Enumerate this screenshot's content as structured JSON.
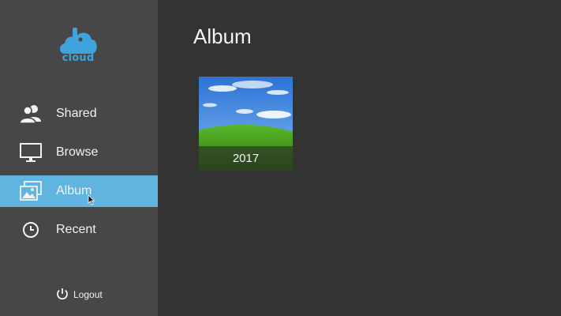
{
  "brand": {
    "logo_text": "cloud",
    "accent_color": "#5fb4e0"
  },
  "sidebar": {
    "items": [
      {
        "label": "Shared",
        "icon": "users-icon",
        "active": false
      },
      {
        "label": "Browse",
        "icon": "monitor-icon",
        "active": false
      },
      {
        "label": "Album",
        "icon": "photos-icon",
        "active": true
      },
      {
        "label": "Recent",
        "icon": "clock-icon",
        "active": false
      }
    ],
    "logout_label": "Logout",
    "logout_icon": "power-icon"
  },
  "main": {
    "title": "Album",
    "albums": [
      {
        "name": "2017",
        "thumbnail": "grass-hill-sky-thumbnail"
      }
    ]
  }
}
